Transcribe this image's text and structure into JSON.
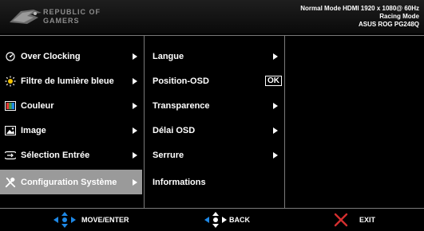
{
  "header": {
    "brand_line1": "REPUBLIC OF",
    "brand_line2": "GAMERS",
    "status_line1": "Normal Mode HDMI 1920 x 1080@ 60Hz",
    "status_line2": "Racing Mode",
    "status_line3": "ASUS ROG PG248Q"
  },
  "menu": {
    "items": [
      {
        "label": "Over Clocking",
        "icon": "overclock-icon"
      },
      {
        "label": "Filtre de lumière bleue",
        "icon": "blue-light-icon"
      },
      {
        "label": "Couleur",
        "icon": "color-icon"
      },
      {
        "label": "Image",
        "icon": "image-icon"
      },
      {
        "label": "Sélection Entrée",
        "icon": "input-icon"
      },
      {
        "label": "Configuration Système",
        "icon": "system-setup-icon",
        "selected": true
      }
    ]
  },
  "submenu": {
    "items": [
      {
        "label": "Langue"
      },
      {
        "label": "Position-OSD",
        "badge": "OK"
      },
      {
        "label": "Transparence"
      },
      {
        "label": "Délai OSD"
      },
      {
        "label": "Serrure"
      },
      {
        "label": "Informations"
      }
    ]
  },
  "footer": {
    "move_enter": "MOVE/ENTER",
    "back": "BACK",
    "exit": "EXIT"
  },
  "colors": {
    "selected_bg": "#9a9a9a",
    "nav_blue": "#1e88e5",
    "exit_red": "#d32f2f"
  }
}
